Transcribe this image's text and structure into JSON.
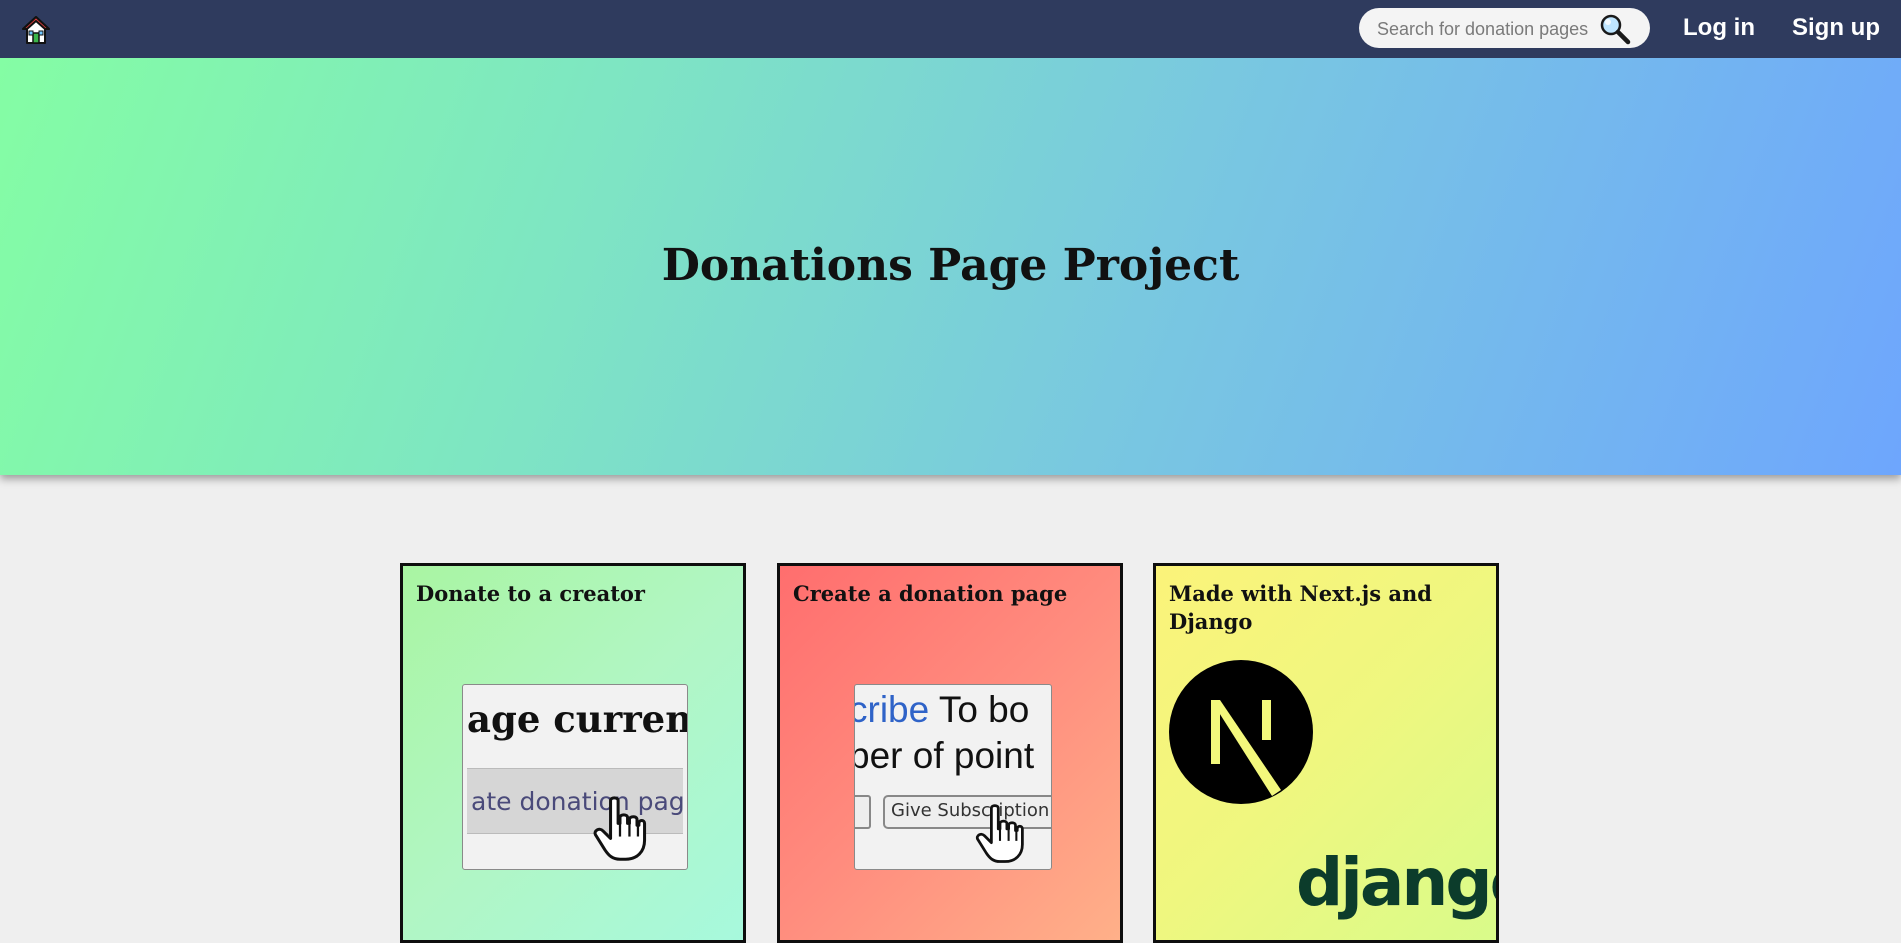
{
  "navbar": {
    "home_icon": "home-icon",
    "search": {
      "placeholder": "Search for donation pages",
      "value": "",
      "icon": "magnifier-icon"
    },
    "login_label": "Log in",
    "signup_label": "Sign up",
    "colors": {
      "background": "#2f3b5e",
      "text": "#ffffff"
    }
  },
  "hero": {
    "title": "Donations Page Project",
    "gradient": [
      "#84fda4",
      "#6ea6fd"
    ]
  },
  "cards": [
    {
      "title": "Donate to a creator",
      "thumb_big_text": "age currentl",
      "thumb_button_text": "ate donation pag",
      "colors": [
        "#a9f5a2",
        "#a7f9dd"
      ]
    },
    {
      "title": "Create a donation page",
      "thumb_big_text_blue": "cribe",
      "thumb_big_text_rest": " To bo",
      "thumb_line2": "per of point",
      "thumb_button_text": "Give Subscription",
      "colors": [
        "#ff6e6e",
        "#ffb089"
      ]
    },
    {
      "title": "Made with Next.js and Django",
      "logos": [
        "nextjs-logo",
        "django-logo"
      ],
      "django_wordmark": "django",
      "colors": [
        "#fbf37a",
        "#d9fb8a"
      ]
    }
  ]
}
